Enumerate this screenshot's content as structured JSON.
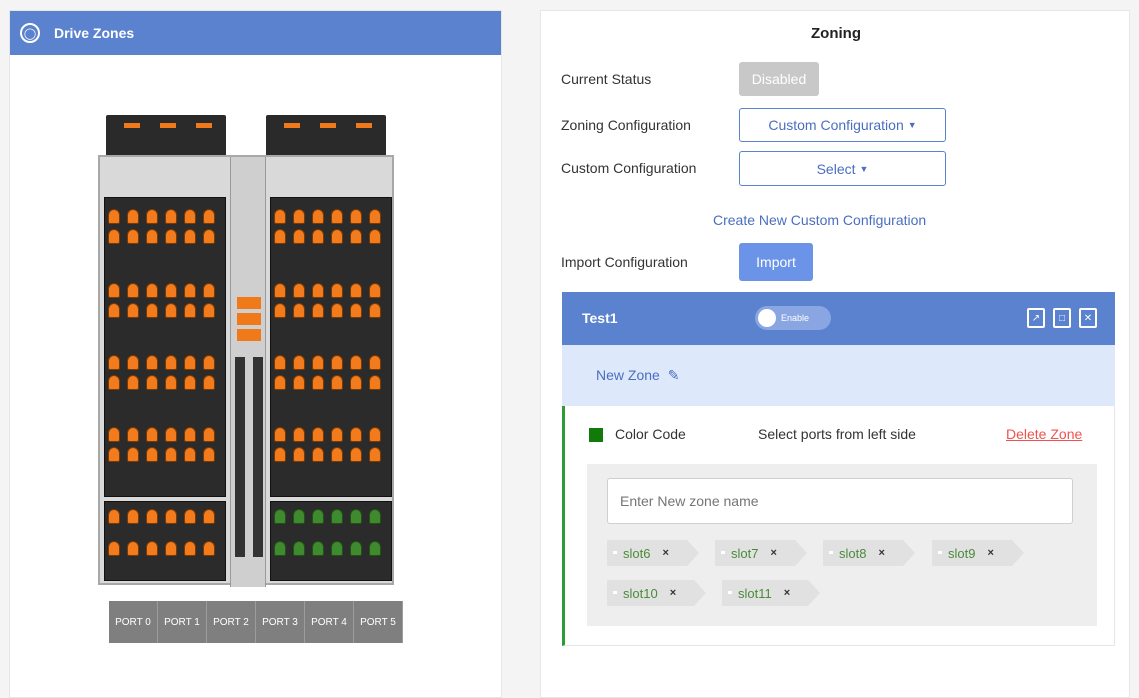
{
  "left": {
    "title": "Drive Zones",
    "ports": [
      "PORT 0",
      "PORT 1",
      "PORT 2",
      "PORT 3",
      "PORT 4",
      "PORT 5"
    ]
  },
  "right": {
    "title": "Zoning",
    "current_status_label": "Current Status",
    "current_status_value": "Disabled",
    "zoning_config_label": "Zoning Configuration",
    "zoning_config_value": "Custom Configuration",
    "custom_config_label": "Custom Configuration",
    "custom_config_value": "Select",
    "create_link": "Create New Custom Configuration",
    "import_label": "Import Configuration",
    "import_button": "Import"
  },
  "config": {
    "name": "Test1",
    "toggle_label": "Enable",
    "zone": {
      "name": "New Zone",
      "color_code_label": "Color Code",
      "color": "#117a0a",
      "instruction": "Select ports from left side",
      "delete_label": "Delete Zone",
      "input_placeholder": "Enter New zone name",
      "slots": [
        "slot6",
        "slot7",
        "slot8",
        "slot9",
        "slot10",
        "slot11"
      ]
    }
  },
  "colors": {
    "header_blue": "#5b82cf",
    "accent_blue": "#4a6fbf",
    "drive_orange": "#f27b1d",
    "drive_green": "#3f8a2e",
    "delete_red": "#ef5350"
  },
  "icons": [
    "drive-zones-icon",
    "dropdown-caret-icon",
    "pencil-icon",
    "export-icon",
    "save-icon",
    "trash-icon",
    "remove-tag-icon"
  ]
}
